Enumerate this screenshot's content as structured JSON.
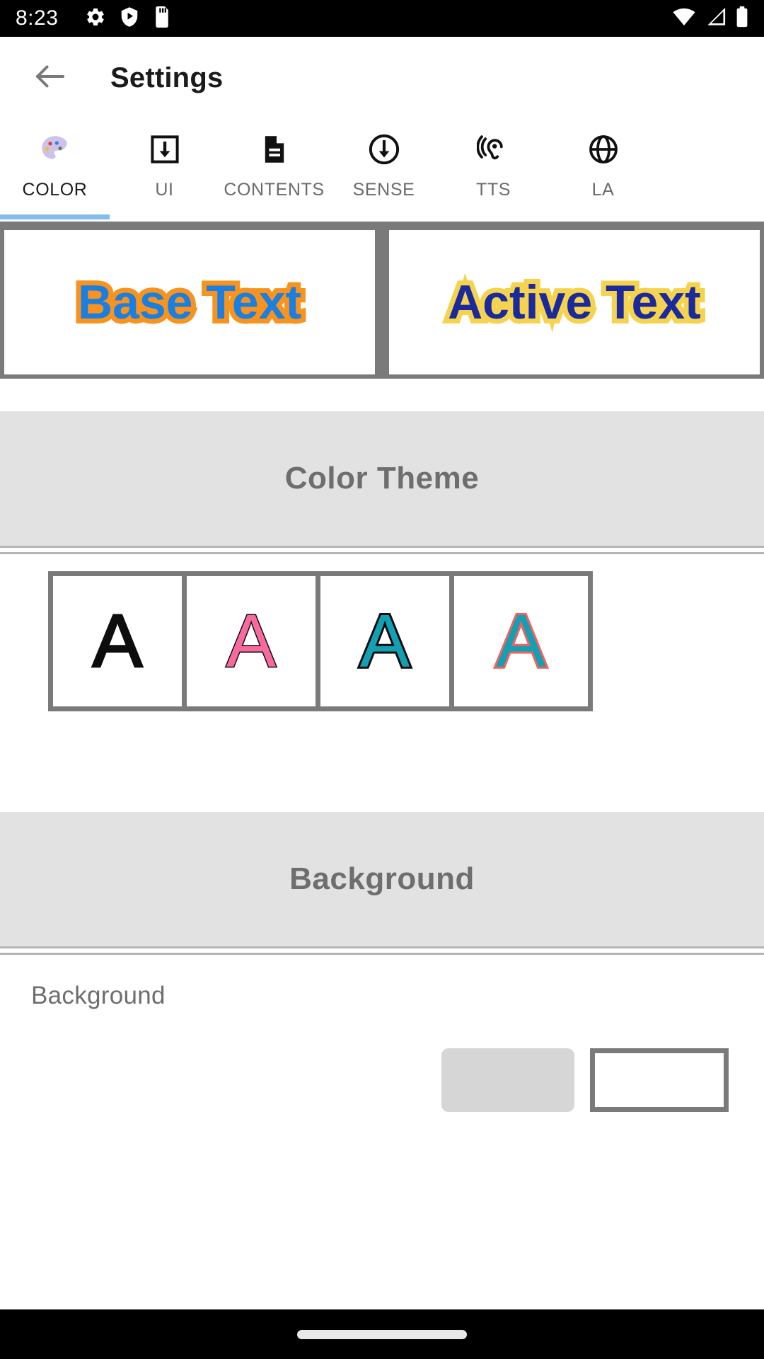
{
  "status_bar": {
    "time": "8:23",
    "left_icons": [
      "gear-icon",
      "shield-play-icon",
      "sd-card-icon"
    ],
    "right_icons": [
      "wifi-icon",
      "cellular-signal-icon",
      "battery-icon"
    ]
  },
  "app_bar": {
    "back_icon": "arrow-left-icon",
    "title": "Settings"
  },
  "tabs": {
    "active_index": 0,
    "indicator_color": "#82BCEA",
    "items": [
      {
        "label": "COLOR",
        "icon": "palette-icon"
      },
      {
        "label": "UI",
        "icon": "download-box-icon"
      },
      {
        "label": "CONTENTS",
        "icon": "document-icon"
      },
      {
        "label": "SENSE",
        "icon": "circle-arrow-down-icon"
      },
      {
        "label": "TTS",
        "icon": "ear-hearing-icon"
      },
      {
        "label": "LA",
        "icon": "language-icon"
      }
    ]
  },
  "preview": {
    "base": {
      "text": "Base Text",
      "fill_color": "#1A7FE0",
      "outline_color": "#F7931E"
    },
    "active": {
      "text": "Active Text",
      "fill_color": "#1A2A9C",
      "outline_color": "#F6D34F"
    }
  },
  "color_theme_section": {
    "header": "Color Theme",
    "swatches": [
      {
        "letter": "A",
        "fill_color": "#0D0D0D",
        "outline_color": "#0D0D0D"
      },
      {
        "letter": "A",
        "fill_color": "#F8699E",
        "outline_color": "#0D0D0D"
      },
      {
        "letter": "A",
        "fill_color": "#13A0B2",
        "outline_color": "#0D0D0D"
      },
      {
        "letter": "A",
        "fill_color": "#13A0B2",
        "outline_color": "#F4605E"
      }
    ]
  },
  "background_section": {
    "header": "Background",
    "row_label": "Background"
  },
  "nav_bar": {
    "home_indicator": "home-indicator-pill"
  }
}
